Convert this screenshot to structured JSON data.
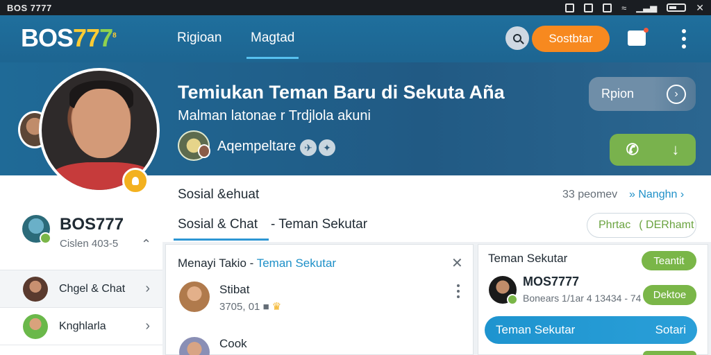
{
  "statusbar": {
    "title": "BOS 7777"
  },
  "nav": {
    "logo": {
      "w": "BOS",
      "y": "77",
      "g": "7",
      "mark": "8"
    },
    "tabs": [
      {
        "label": "Rigioan"
      },
      {
        "label": "Magtad"
      }
    ],
    "cta_label": "Sostbtar"
  },
  "hero": {
    "title": "Temiukan Teman Baru di Sekuta Aña",
    "subtitle": "Malman latonae r Trdjlola akuni",
    "meta": "Aqempeltare",
    "pill_label": "Rpion"
  },
  "sidebar": {
    "brand": {
      "name": "BOS777",
      "sub": "Cislen 403-5"
    },
    "items": [
      {
        "label": "Chgel & Chat",
        "avatar_color": "#7a5140"
      },
      {
        "label": "Knghlarla",
        "avatar_color": "#6ab84a"
      }
    ]
  },
  "main": {
    "section_title": "Sosial &ehuat",
    "count": "33 peomev",
    "link": "Nanghn",
    "tabs": [
      {
        "label": "Sosial & Chat"
      },
      {
        "label": "- Teman Sekutar"
      }
    ],
    "filter": {
      "a": "Phrtac",
      "b": "DERhamt"
    }
  },
  "card_left": {
    "head": "Menayi Takio - ",
    "head_accent": "Teman Sekutar",
    "rows": [
      {
        "name": "Stibat",
        "meta": "3705, 01",
        "avatar_color": "#b07a4c"
      },
      {
        "name": "Cook",
        "meta": "",
        "avatar_color": "#8a8fb5"
      }
    ]
  },
  "card_right": {
    "title": "Teman Sekutar",
    "btn1": "Teantit",
    "name": "MOS7777",
    "meta": "Bonears 1/1ar 4 13434 - 74",
    "btn2": "Dektoe",
    "bar_left": "Teman Sekutar",
    "bar_right": "Sotari"
  }
}
